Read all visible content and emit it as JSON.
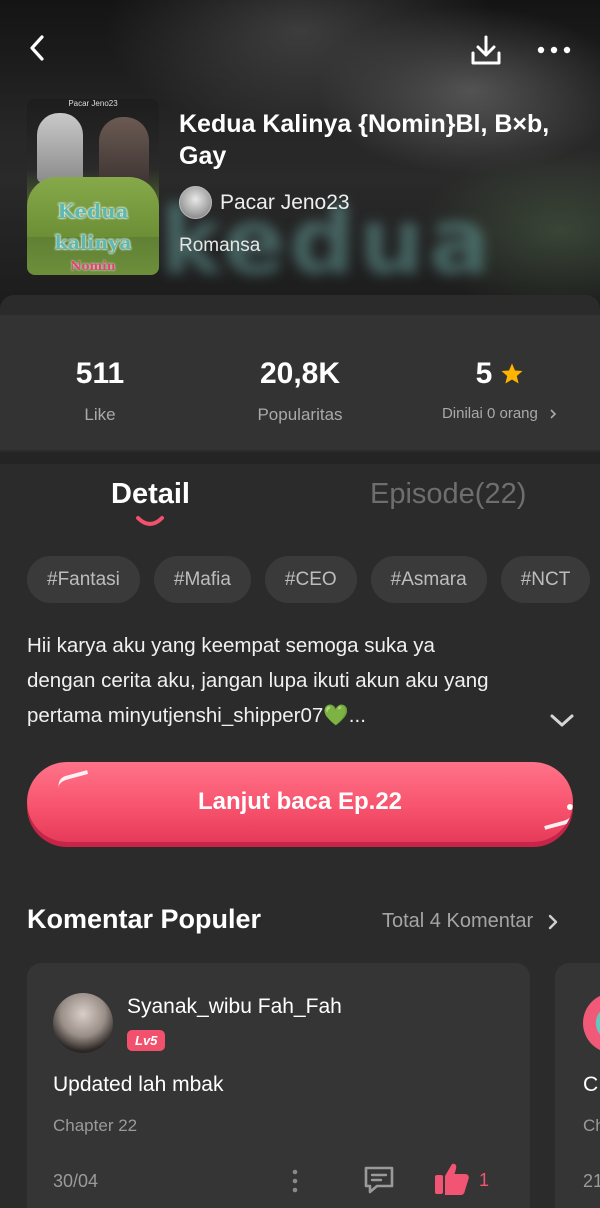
{
  "header": {
    "cover_top_label": "Pacar Jeno23",
    "cover_title_line1": "Kedua",
    "cover_title_line2": "kalinya",
    "cover_title_line3": "Nomin",
    "title": "Kedua Kalinya {Nomin}Bl, B×b, Gay",
    "author": "Pacar Jeno23",
    "genre": "Romansa",
    "background_word": "kedua",
    "icons": {
      "back": "back-arrow-icon",
      "download": "download-icon",
      "more": "more-dots-icon"
    }
  },
  "stats": {
    "likes_value": "511",
    "likes_label": "Like",
    "popularity_value": "20,8K",
    "popularity_label": "Popularitas",
    "rating_value": "5",
    "rating_label": "Dinilai 0 orang",
    "rating_star_color": "#ffb400"
  },
  "tabs": {
    "detail": "Detail",
    "episode": "Episode(22)",
    "active": "detail",
    "accent_color": "#f2516d"
  },
  "tags": [
    "#Fantasi",
    "#Mafia",
    "#CEO",
    "#Asmara",
    "#NCT"
  ],
  "synopsis": {
    "line1": "Hii karya aku yang keempat semoga suka ya",
    "line2": "dengan cerita aku, jangan lupa ikuti akun aku yang",
    "line3": "pertama minyutjenshi_shipper07💚..."
  },
  "continue_button": {
    "label": "Lanjut baca Ep.22",
    "color": "#f8546e"
  },
  "comments_section": {
    "title": "Komentar Populer",
    "total_label": "Total 4 Komentar",
    "comments": [
      {
        "user": "Syanak_wibu Fah_Fah",
        "level": "Lv5",
        "text": "Updated lah mbak",
        "chapter": "Chapter 22",
        "date": "30/04",
        "likes": "1"
      },
      {
        "text": "C",
        "chapter": "Ch",
        "date": "21"
      }
    ]
  }
}
